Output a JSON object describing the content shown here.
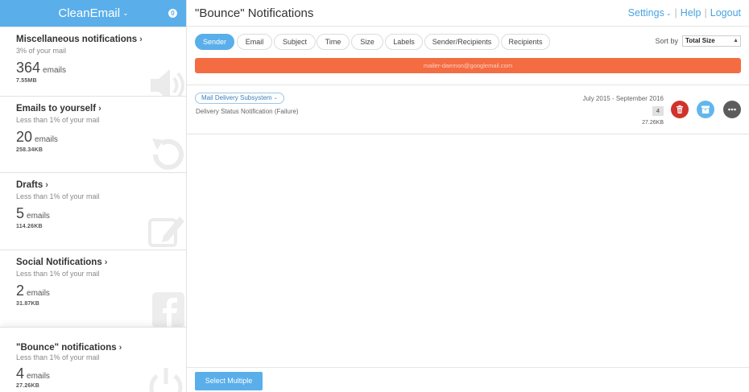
{
  "brand": {
    "title": "CleanEmail",
    "badge": "0"
  },
  "header": {
    "title": "\"Bounce\" Notifications",
    "nav": {
      "settings": "Settings",
      "help": "Help",
      "logout": "Logout"
    }
  },
  "sidebar": {
    "categories": [
      {
        "title": "Miscellaneous notifications",
        "subtitle": "3% of your mail",
        "count": "364",
        "unit": "emails",
        "size": "7.55MB",
        "icon": "speaker-icon"
      },
      {
        "title": "Emails to yourself",
        "subtitle": "Less than 1% of your mail",
        "count": "20",
        "unit": "emails",
        "size": "258.34KB",
        "icon": "undo-arrow-icon"
      },
      {
        "title": "Drafts",
        "subtitle": "Less than 1% of your mail",
        "count": "5",
        "unit": "emails",
        "size": "114.26KB",
        "icon": "edit-icon"
      },
      {
        "title": "Social Notifications",
        "subtitle": "Less than 1% of your mail",
        "count": "2",
        "unit": "emails",
        "size": "31.87KB",
        "icon": "facebook-icon"
      },
      {
        "title": "\"Bounce\" notifications",
        "subtitle": "Less than 1% of your mail",
        "count": "4",
        "unit": "emails",
        "size": "27.26KB",
        "icon": "power-icon"
      }
    ]
  },
  "filters": {
    "tabs": [
      "Sender",
      "Email",
      "Subject",
      "Time",
      "Size",
      "Labels",
      "Sender/Recipients",
      "Recipients"
    ],
    "active": "Sender",
    "sort_label": "Sort by",
    "sort_value": "Total Size"
  },
  "group": {
    "sender_email": "mailer-daemon@googlemail.com"
  },
  "email_row": {
    "sender": "Mail Delivery Subsystem",
    "subject": "Delivery Status Notification (Failure)",
    "date_range": "July 2015 - September 2016",
    "count": "4",
    "size": "27.26KB"
  },
  "footer": {
    "select_multiple": "Select Multiple"
  },
  "colors": {
    "accent": "#5aaeea",
    "sender_bar": "#f46c42",
    "delete": "#d0332b",
    "archive": "#62b6ee",
    "more": "#5c5c5c"
  }
}
